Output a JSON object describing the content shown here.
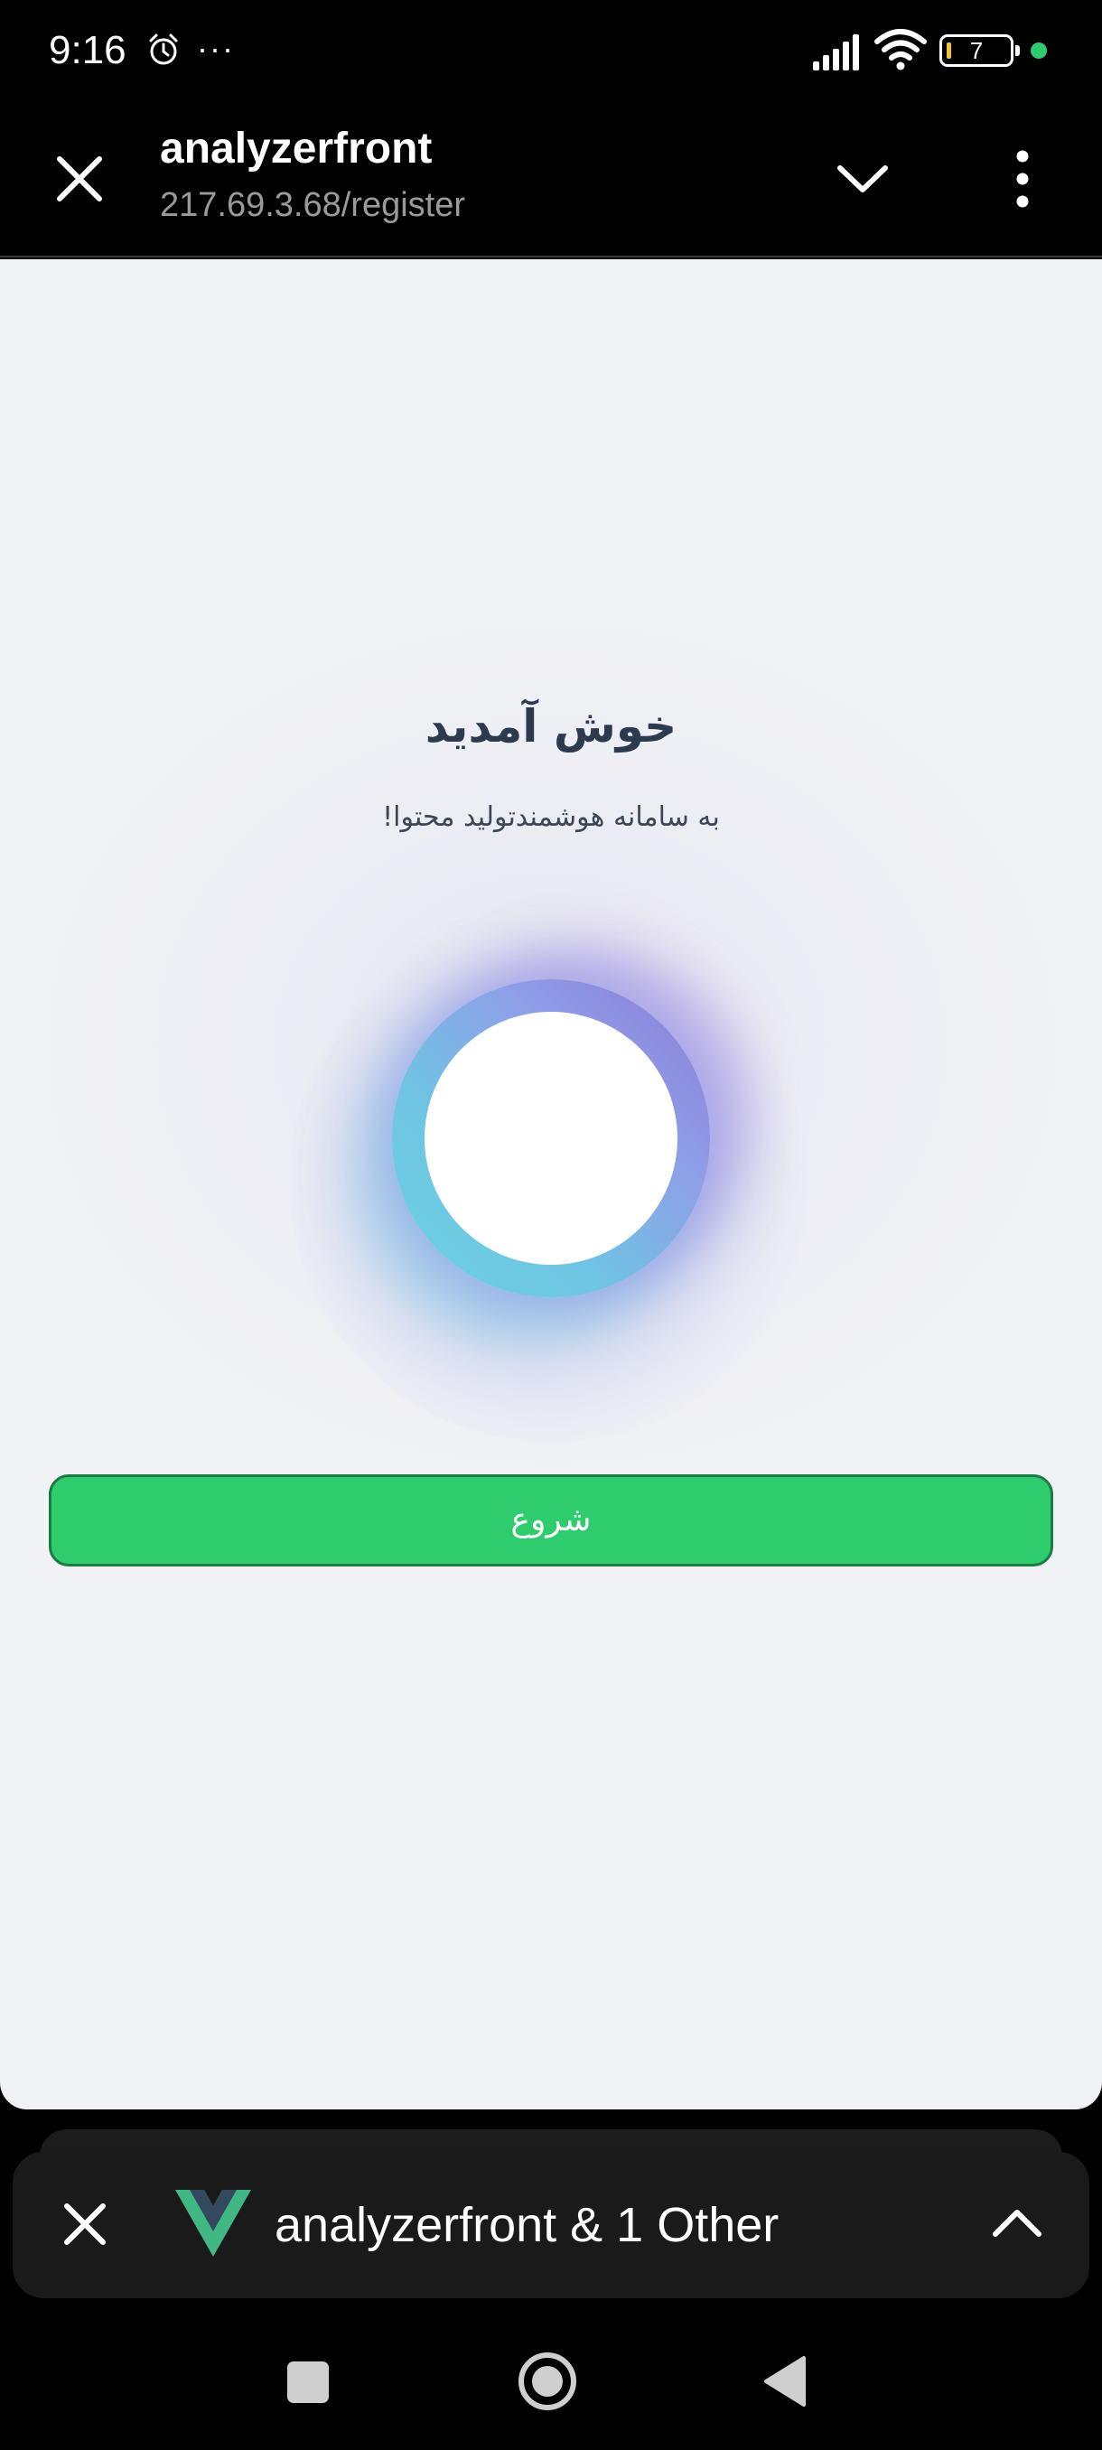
{
  "status_bar": {
    "time": "9:16",
    "alarm_icon": "alarm-icon",
    "more_indicator": "···",
    "signal_icon": "signal-icon",
    "wifi_icon": "wifi-icon",
    "battery_level": "7",
    "battery_color": "#f5c431",
    "dot_color": "#2ecc71"
  },
  "toolbar": {
    "title": "analyzerfront",
    "url": "217.69.3.68/register",
    "close_icon": "close-icon",
    "collapse_icon": "chevron-down-icon",
    "menu_icon": "more-vertical-icon"
  },
  "page": {
    "title": "خوش آمدید",
    "subtitle": "به سامانه هوشمندتولید محتوا!",
    "start_button_label": "شروع",
    "start_button_color": "#2ecc6d",
    "orb_colors": [
      "#8f7ad8",
      "#6ad3de"
    ]
  },
  "tab_bar": {
    "label": "analyzerfront & 1 Other",
    "close_icon": "close-icon",
    "logo_icon": "vue-logo-icon",
    "expand_icon": "chevron-up-icon"
  },
  "nav_bar": {
    "recents_icon": "recents-square-icon",
    "home_icon": "home-circle-icon",
    "back_icon": "back-triangle-icon"
  }
}
